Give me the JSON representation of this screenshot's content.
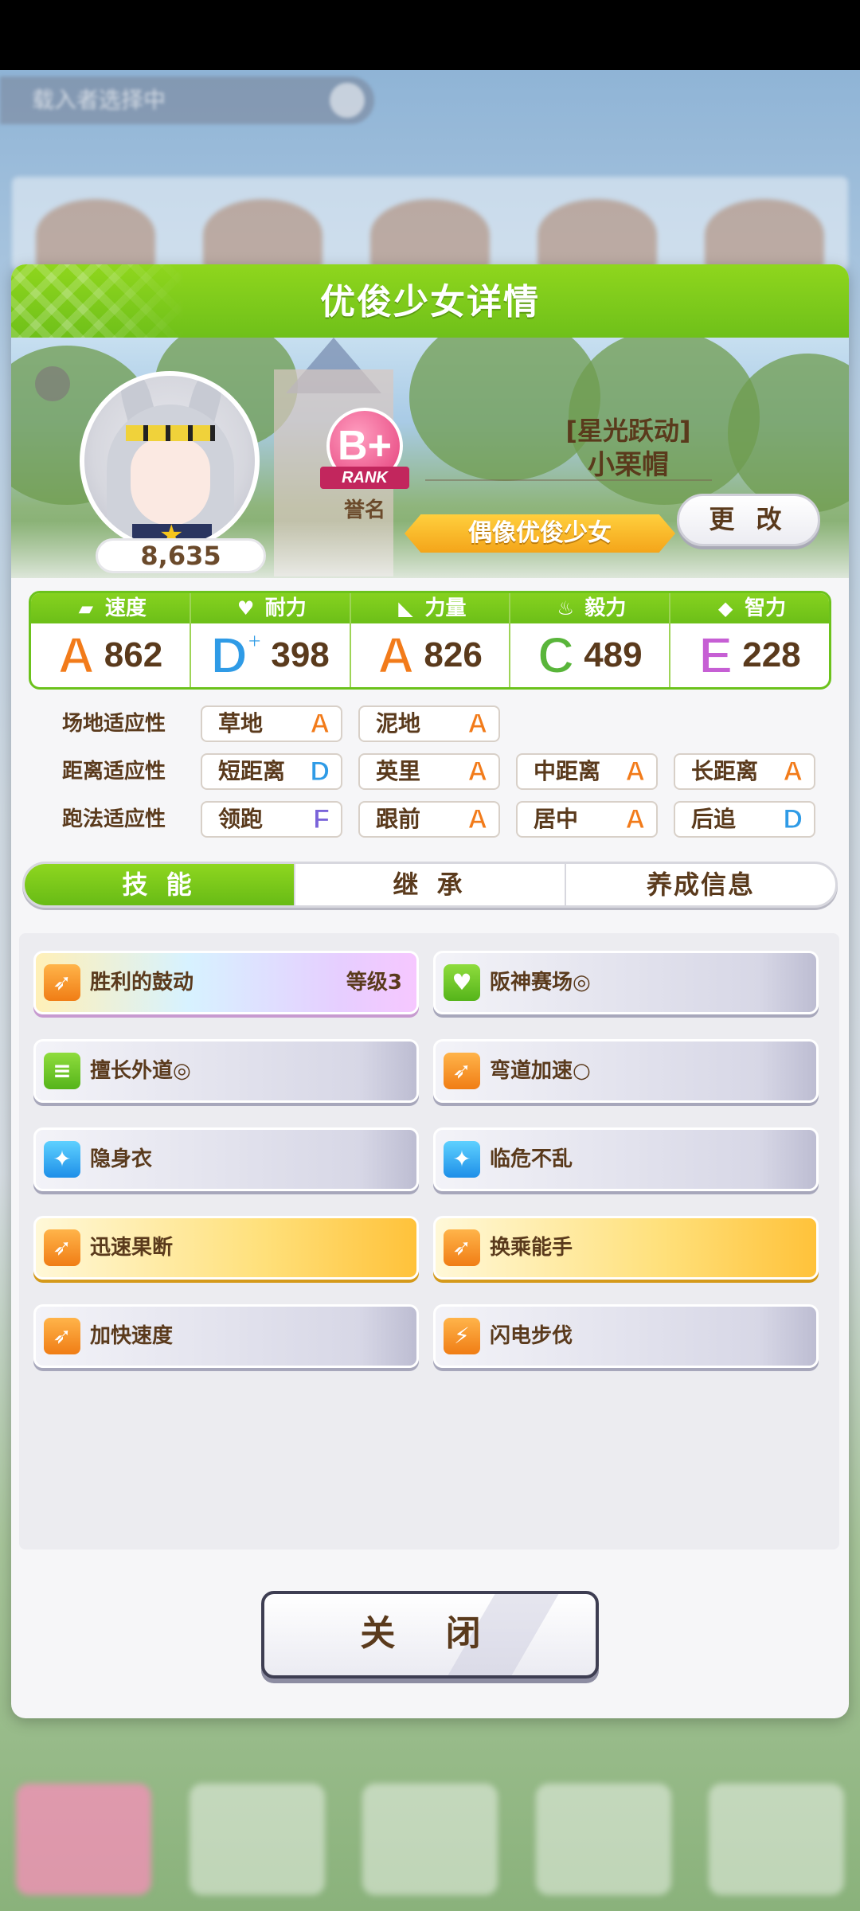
{
  "background": {
    "top_pill_text": "载入者选择中"
  },
  "dialog": {
    "title": "优俊少女详情"
  },
  "character": {
    "fan_count": "8,635",
    "rank_letter": "B+",
    "rank_ribbon": "RANK",
    "rank_label": "誉名",
    "outfit_title": "[星光跃动]",
    "name": "小栗帽",
    "type_banner": "偶像优俊少女",
    "change_button": "更 改"
  },
  "stats": [
    {
      "label": "速度",
      "icon": "shoe-icon",
      "grade": "A",
      "grade_plus": "",
      "value": "862"
    },
    {
      "label": "耐力",
      "icon": "heart-icon",
      "grade": "D",
      "grade_plus": "+",
      "value": "398"
    },
    {
      "label": "力量",
      "icon": "muscle-icon",
      "grade": "A",
      "grade_plus": "",
      "value": "826"
    },
    {
      "label": "毅力",
      "icon": "flame-icon",
      "grade": "C",
      "grade_plus": "",
      "value": "489"
    },
    {
      "label": "智力",
      "icon": "graduation-cap-icon",
      "grade": "E",
      "grade_plus": "",
      "value": "228"
    }
  ],
  "aptitudes": {
    "track": {
      "label": "场地适应性",
      "items": [
        {
          "name": "草地",
          "grade": "A"
        },
        {
          "name": "泥地",
          "grade": "A"
        }
      ]
    },
    "distance": {
      "label": "距离适应性",
      "items": [
        {
          "name": "短距离",
          "grade": "D"
        },
        {
          "name": "英里",
          "grade": "A"
        },
        {
          "name": "中距离",
          "grade": "A"
        },
        {
          "name": "长距离",
          "grade": "A"
        }
      ]
    },
    "strategy": {
      "label": "跑法适应性",
      "items": [
        {
          "name": "领跑",
          "grade": "F"
        },
        {
          "name": "跟前",
          "grade": "A"
        },
        {
          "name": "居中",
          "grade": "A"
        },
        {
          "name": "后追",
          "grade": "D"
        }
      ]
    }
  },
  "tabs": [
    {
      "label": "技 能",
      "active": true
    },
    {
      "label": "继 承",
      "active": false
    },
    {
      "label": "养成信息",
      "active": false
    }
  ],
  "skills": [
    {
      "name": "胜利的鼓动",
      "level": "等级3",
      "style": "rainbow",
      "icon": "orange-speed-icon"
    },
    {
      "name": "阪神赛场◎",
      "level": "",
      "style": "normal",
      "icon": "green-heart-icon"
    },
    {
      "name": "擅长外道◎",
      "level": "",
      "style": "normal",
      "icon": "green-lane-icon"
    },
    {
      "name": "弯道加速○",
      "level": "",
      "style": "normal",
      "icon": "orange-speed-icon"
    },
    {
      "name": "隐身衣",
      "level": "",
      "style": "normal",
      "icon": "blue-sparkle-icon"
    },
    {
      "name": "临危不乱",
      "level": "",
      "style": "normal",
      "icon": "blue-sparkle-icon"
    },
    {
      "name": "迅速果断",
      "level": "",
      "style": "gold",
      "icon": "orange-speed-icon"
    },
    {
      "name": "换乘能手",
      "level": "",
      "style": "gold",
      "icon": "orange-speed-icon"
    },
    {
      "name": "加快速度",
      "level": "",
      "style": "normal",
      "icon": "orange-speed-icon"
    },
    {
      "name": "闪电步伐",
      "level": "",
      "style": "normal",
      "icon": "orange-bolt-icon"
    }
  ],
  "close_button": "关 闭"
}
